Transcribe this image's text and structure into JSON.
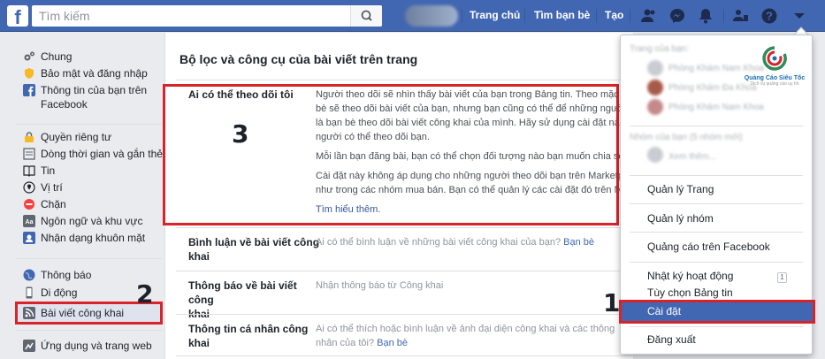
{
  "topbar": {
    "logo": "f",
    "search_placeholder": "Tìm kiếm",
    "nav": [
      "Trang chủ",
      "Tìm bạn bè",
      "Tạo"
    ]
  },
  "sidebar": {
    "group1": [
      "Chung",
      "Bảo mật và đăng nhập",
      "Thông tin của bạn trên",
      "Facebook"
    ],
    "group2": [
      "Quyền riêng tư",
      "Dòng thời gian và gắn thẻ",
      "Tin",
      "Vị trí",
      "Chặn",
      "Ngôn ngữ và khu vực",
      "Nhận dạng khuôn mặt"
    ],
    "group3": [
      "Thông báo",
      "Di động",
      "Bài viết công khai"
    ],
    "group4": [
      "Ứng dụng và trang web"
    ]
  },
  "main": {
    "title": "Bộ lọc và công cụ của bài viết trên trang",
    "follow": {
      "label": "Ai có thể theo dõi tôi",
      "lines": [
        "Người theo dõi sẽ nhìn thấy bài viết của bạn trong Bảng tin. Theo mặc đ",
        "bè sẽ theo dõi bài viết của bạn, nhưng bạn cũng có thể để những người",
        "là bạn bè theo dõi bài viết công khai của mình. Hãy sử dụng cài đặt này",
        "người có thể theo dõi bạn."
      ],
      "line5": "Mỗi lần bạn đăng bài, bạn có thể chọn đối tượng nào bạn muốn chia sẻ",
      "line6": "Cài đặt này không áp dụng cho những người theo dõi bạn trên Marketp",
      "line7": "như trong các nhóm mua bán. Bạn có thể quản lý các cài đặt đó trên Ma",
      "learn_more": "Tìm hiểu thêm."
    },
    "comments": {
      "label1": "Bình luận về bài viết công",
      "label2": "khai",
      "desc": "Ai có thể bình luận về những bài viết công khai của bạn?",
      "value": "Bạn bè"
    },
    "notify": {
      "label1": "Thông báo về bài viết công",
      "label2": "khai",
      "desc": "Nhận thông báo từ Công khai"
    },
    "profile": {
      "label": "Thông tin cá nhân công khai",
      "desc1": "Ai có thể thích hoặc bình luận về ảnh đại diện công khai và các thông",
      "desc2": "nhân của tôi?",
      "value": "Bạn bè"
    }
  },
  "dropdown": {
    "blurred_header1": "Trang của bạn:",
    "blurred_header2": "Nhóm của bạn (5 nhóm mới)",
    "blurred_items": [
      "Phòng Khám Nam Khoa",
      "Phòng Khám Đa Khoa",
      "Phòng Khám Nam Khoa",
      "Xem thêm..."
    ],
    "items": [
      "Quản lý Trang",
      "Quản lý nhóm",
      "Quảng cáo trên Facebook",
      "Nhật ký hoạt động",
      "Tùy chọn Bảng tin",
      "Cài đặt",
      "Đăng xuất"
    ],
    "activity_badge": "1",
    "brand_name": "Quảng Cáo Siêu Tốc",
    "brand_sub": "Dịch vụ quảng cáo uy tín"
  },
  "annotations": [
    "1",
    "2",
    "3"
  ],
  "colors": {
    "brand": "#4267b2",
    "highlight": "#d9232b"
  }
}
